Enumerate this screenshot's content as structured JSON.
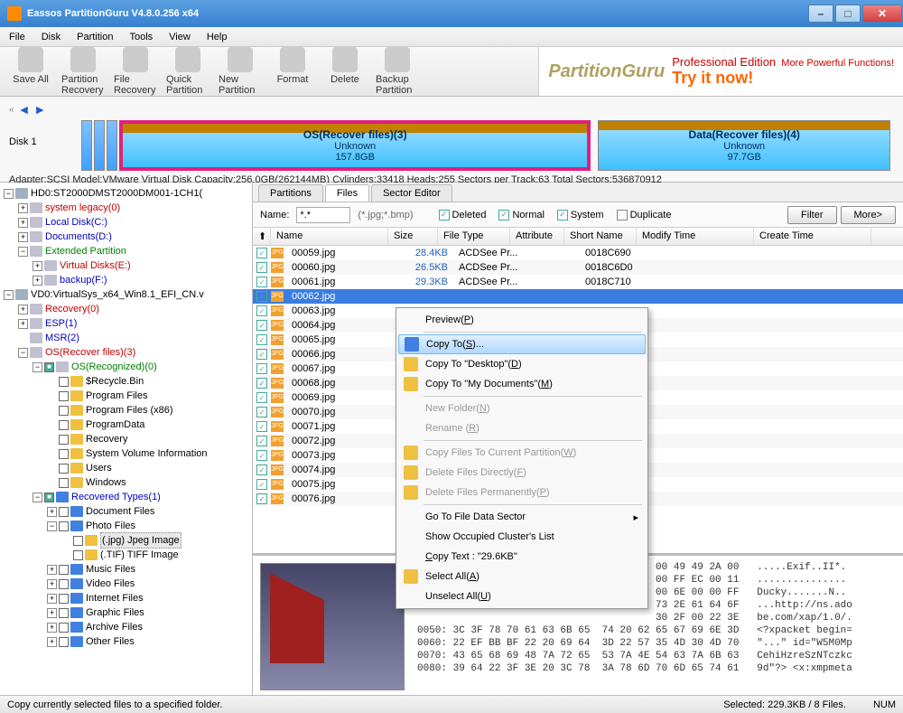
{
  "title": "Eassos PartitionGuru V4.8.0.256 x64",
  "menus": [
    "File",
    "Disk",
    "Partition",
    "Tools",
    "View",
    "Help"
  ],
  "toolbar": [
    {
      "label": "Save All"
    },
    {
      "label": "Partition Recovery"
    },
    {
      "label": "File Recovery"
    },
    {
      "label": "Quick Partition"
    },
    {
      "label": "New Partition"
    },
    {
      "label": "Format"
    },
    {
      "label": "Delete"
    },
    {
      "label": "Backup Partition"
    }
  ],
  "banner": {
    "logo": "PartitionGuru",
    "prof": "Professional Edition",
    "more": "More Powerful Functions!",
    "try": "Try it now!"
  },
  "disk": {
    "label": "Disk 1",
    "parts": [
      {
        "name": "OS(Recover files)(3)",
        "fs": "Unknown",
        "size": "157.8GB",
        "sel": true
      },
      {
        "name": "Data(Recover files)(4)",
        "fs": "Unknown",
        "size": "97.7GB",
        "sel": false
      }
    ],
    "info": "Adapter:SCSI  Model:VMware Virtual Disk  Capacity:256.0GB(262144MB)  Cylinders:33418  Heads:255  Sectors per Track:63  Total Sectors:536870912"
  },
  "tree": [
    {
      "d": 0,
      "tw": "-",
      "ico": "disk",
      "txt": "HD0:ST2000DMST2000DM001-1CH1("
    },
    {
      "d": 1,
      "tw": "+",
      "ico": "drive",
      "txt": "system legacy(0)",
      "cls": "red"
    },
    {
      "d": 1,
      "tw": "+",
      "ico": "drive",
      "txt": "Local Disk(C:)",
      "cls": "blue"
    },
    {
      "d": 1,
      "tw": "+",
      "ico": "drive",
      "txt": "Documents(D:)",
      "cls": "blue"
    },
    {
      "d": 1,
      "tw": "-",
      "ico": "drive",
      "txt": "Extended Partition",
      "cls": "green"
    },
    {
      "d": 2,
      "tw": "+",
      "ico": "drive",
      "txt": "Virtual Disks(E:)",
      "cls": "red"
    },
    {
      "d": 2,
      "tw": "+",
      "ico": "drive",
      "txt": "backup(F:)",
      "cls": "blue"
    },
    {
      "d": 0,
      "tw": "-",
      "ico": "disk",
      "txt": "VD0:VirtualSys_x64_Win8.1_EFI_CN.v"
    },
    {
      "d": 1,
      "tw": "+",
      "ico": "drive",
      "txt": "Recovery(0)",
      "cls": "red"
    },
    {
      "d": 1,
      "tw": "+",
      "ico": "drive",
      "txt": "ESP(1)",
      "cls": "blue"
    },
    {
      "d": 1,
      "tw": "",
      "ico": "drive",
      "txt": "MSR(2)",
      "cls": "blue"
    },
    {
      "d": 1,
      "tw": "-",
      "ico": "drive",
      "txt": "OS(Recover files)(3)",
      "cls": "red"
    },
    {
      "d": 2,
      "tw": "-",
      "chk": "g",
      "ico": "drive",
      "txt": "OS(Recognized)(0)",
      "cls": "green"
    },
    {
      "d": 3,
      "tw": "",
      "chk": "",
      "ico": "",
      "txt": "$Recycle.Bin"
    },
    {
      "d": 3,
      "tw": "",
      "chk": "",
      "ico": "",
      "txt": "Program Files"
    },
    {
      "d": 3,
      "tw": "",
      "chk": "",
      "ico": "",
      "txt": "Program Files (x86)"
    },
    {
      "d": 3,
      "tw": "",
      "chk": "",
      "ico": "",
      "txt": "ProgramData"
    },
    {
      "d": 3,
      "tw": "",
      "chk": "",
      "ico": "",
      "txt": "Recovery"
    },
    {
      "d": 3,
      "tw": "",
      "chk": "",
      "ico": "",
      "txt": "System Volume Information"
    },
    {
      "d": 3,
      "tw": "",
      "chk": "",
      "ico": "",
      "txt": "Users"
    },
    {
      "d": 3,
      "tw": "",
      "chk": "",
      "ico": "",
      "txt": "Windows"
    },
    {
      "d": 2,
      "tw": "-",
      "chk": "g",
      "ico": "blue",
      "txt": "Recovered Types(1)",
      "cls": "blue"
    },
    {
      "d": 3,
      "tw": "+",
      "chk": "",
      "ico": "blue",
      "txt": "Document Files"
    },
    {
      "d": 3,
      "tw": "-",
      "chk": "",
      "ico": "blue",
      "txt": "Photo Files"
    },
    {
      "d": 4,
      "tw": "",
      "chk": "",
      "ico": "",
      "txt": "(.jpg) Jpeg Image",
      "sel": true
    },
    {
      "d": 4,
      "tw": "",
      "chk": "",
      "ico": "",
      "txt": "(.TIF) TIFF Image"
    },
    {
      "d": 3,
      "tw": "+",
      "chk": "",
      "ico": "blue",
      "txt": "Music Files"
    },
    {
      "d": 3,
      "tw": "+",
      "chk": "",
      "ico": "blue",
      "txt": "Video Files"
    },
    {
      "d": 3,
      "tw": "+",
      "chk": "",
      "ico": "blue",
      "txt": "Internet Files"
    },
    {
      "d": 3,
      "tw": "+",
      "chk": "",
      "ico": "blue",
      "txt": "Graphic Files"
    },
    {
      "d": 3,
      "tw": "+",
      "chk": "",
      "ico": "blue",
      "txt": "Archive Files"
    },
    {
      "d": 3,
      "tw": "+",
      "chk": "",
      "ico": "blue",
      "txt": "Other Files"
    }
  ],
  "tabs": [
    "Partitions",
    "Files",
    "Sector Editor"
  ],
  "activeTab": 1,
  "filter": {
    "nameLabel": "Name:",
    "nameValue": "*.*",
    "ext": "(*.jpg;*.bmp)",
    "checks": [
      {
        "label": "Deleted",
        "on": true
      },
      {
        "label": "Normal",
        "on": true
      },
      {
        "label": "System",
        "on": true
      },
      {
        "label": "Duplicate",
        "on": false
      }
    ],
    "filterBtn": "Filter",
    "moreBtn": "More>"
  },
  "cols": [
    "Name",
    "Size",
    "File Type",
    "Attribute",
    "Short Name",
    "Modify Time",
    "Create Time"
  ],
  "files": [
    {
      "n": "00059.jpg",
      "s": "28.4KB",
      "t": "ACDSee Pr...",
      "sn": "0018C690"
    },
    {
      "n": "00060.jpg",
      "s": "26.5KB",
      "t": "ACDSee Pr...",
      "sn": "0018C6D0"
    },
    {
      "n": "00061.jpg",
      "s": "29.3KB",
      "t": "ACDSee Pr...",
      "sn": "0018C710"
    },
    {
      "n": "00062.jpg",
      "s": "",
      "t": "",
      "sn": "",
      "sel": true
    },
    {
      "n": "00063.jpg"
    },
    {
      "n": "00064.jpg"
    },
    {
      "n": "00065.jpg"
    },
    {
      "n": "00066.jpg"
    },
    {
      "n": "00067.jpg"
    },
    {
      "n": "00068.jpg"
    },
    {
      "n": "00069.jpg"
    },
    {
      "n": "00070.jpg"
    },
    {
      "n": "00071.jpg"
    },
    {
      "n": "00072.jpg"
    },
    {
      "n": "00073.jpg"
    },
    {
      "n": "00074.jpg"
    },
    {
      "n": "00075.jpg"
    },
    {
      "n": "00076.jpg"
    }
  ],
  "ctx": [
    {
      "type": "item",
      "label": "Preview(",
      "u": "P",
      "after": ")"
    },
    {
      "type": "sep"
    },
    {
      "type": "item",
      "ico": "blue",
      "label": "Copy To(",
      "u": "S",
      "after": ")...",
      "hl": true
    },
    {
      "type": "item",
      "ico": "fold",
      "label": "Copy To \"Desktop\"(",
      "u": "D",
      "after": ")"
    },
    {
      "type": "item",
      "ico": "fold",
      "label": "Copy To \"My Documents\"(",
      "u": "M",
      "after": ")"
    },
    {
      "type": "sep"
    },
    {
      "type": "item",
      "dis": true,
      "label": "New Folder(",
      "u": "N",
      "after": ")"
    },
    {
      "type": "item",
      "dis": true,
      "label": "Rename (",
      "u": "R",
      "after": ")"
    },
    {
      "type": "sep"
    },
    {
      "type": "item",
      "dis": true,
      "ico": "g",
      "label": "Copy Files To Current Partition(",
      "u": "W",
      "after": ")"
    },
    {
      "type": "item",
      "dis": true,
      "ico": "g",
      "label": "Delete Files Directly(",
      "u": "F",
      "after": ")"
    },
    {
      "type": "item",
      "dis": true,
      "ico": "g",
      "label": "Delete Files Permanently(",
      "u": "P",
      "after": ")"
    },
    {
      "type": "sep"
    },
    {
      "type": "item",
      "label": "Go To File Data Sector",
      "arrow": true
    },
    {
      "type": "item",
      "label": "Show Occupied Cluster's List"
    },
    {
      "type": "item",
      "label": "",
      "pre": "C",
      "prelabel": "opy Text : \"29.6KB\""
    },
    {
      "type": "item",
      "ico": "chk",
      "label": "Select All(",
      "u": "A",
      "after": ")"
    },
    {
      "type": "item",
      "label": "Unselect All(",
      "u": "U",
      "after": ")"
    }
  ],
  "hex": "                                        00 49 49 2A 00   .....Exif..II*.\n                                        00 FF EC 00 11   ...............\n                                        00 6E 00 00 FF   Ducky.......N..\n                                        73 2E 61 64 6F   ...http://ns.ado\n                                        30 2F 00 22 3E   be.com/xap/1.0/.\n0050: 3C 3F 78 70 61 63 6B 65  74 20 62 65 67 69 6E 3D   <?xpacket begin=\n0060: 22 EF BB BF 22 20 69 64  3D 22 57 35 4D 30 4D 70   \"...\" id=\"W5M0Mp\n0070: 43 65 68 69 48 7A 72 65  53 7A 4E 54 63 7A 6B 63   CehiHzreSzNTczkc\n0080: 39 64 22 3F 3E 20 3C 78  3A 78 6D 70 6D 65 74 61   9d\"?> <x:xmpmeta",
  "status": {
    "left": "Copy currently selected files to a specified folder.",
    "sel": "Selected: 229.3KB / 8 Files.",
    "num": "NUM"
  }
}
